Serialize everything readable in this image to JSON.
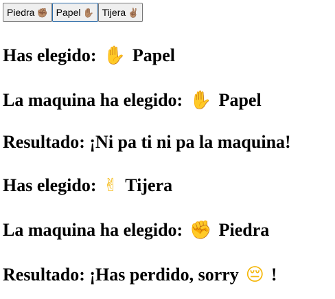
{
  "buttons": [
    {
      "label": "Piedra",
      "icon": "✊🏽",
      "icon_name": "fist-icon"
    },
    {
      "label": "Papel",
      "icon": "✋🏽",
      "icon_name": "raised-hand-icon",
      "focused": true
    },
    {
      "label": "Tijera",
      "icon": "✌🏽",
      "icon_name": "victory-hand-icon"
    }
  ],
  "rounds": [
    {
      "user_prefix": "Has elegido:",
      "user_icon": "✋",
      "user_choice": "Papel",
      "machine_prefix": "La maquina ha elegido:",
      "machine_icon": "✋",
      "machine_choice": "Papel",
      "result_text": "Resultado: ¡Ni pa ti ni pa la maquina!",
      "result_icon": "",
      "result_suffix": ""
    },
    {
      "user_prefix": "Has elegido:",
      "user_icon": "✌",
      "user_choice": "Tijera",
      "machine_prefix": "La maquina ha elegido:",
      "machine_icon": "✊",
      "machine_choice": "Piedra",
      "result_text": "Resultado: ¡Has perdido, sorry",
      "result_icon": "😔",
      "result_suffix": "!"
    }
  ],
  "colors": {
    "emoji_yellow": "#f5b70b",
    "button_bg": "#efefef",
    "button_border": "#767676",
    "focus_border": "#2a6aa8"
  }
}
